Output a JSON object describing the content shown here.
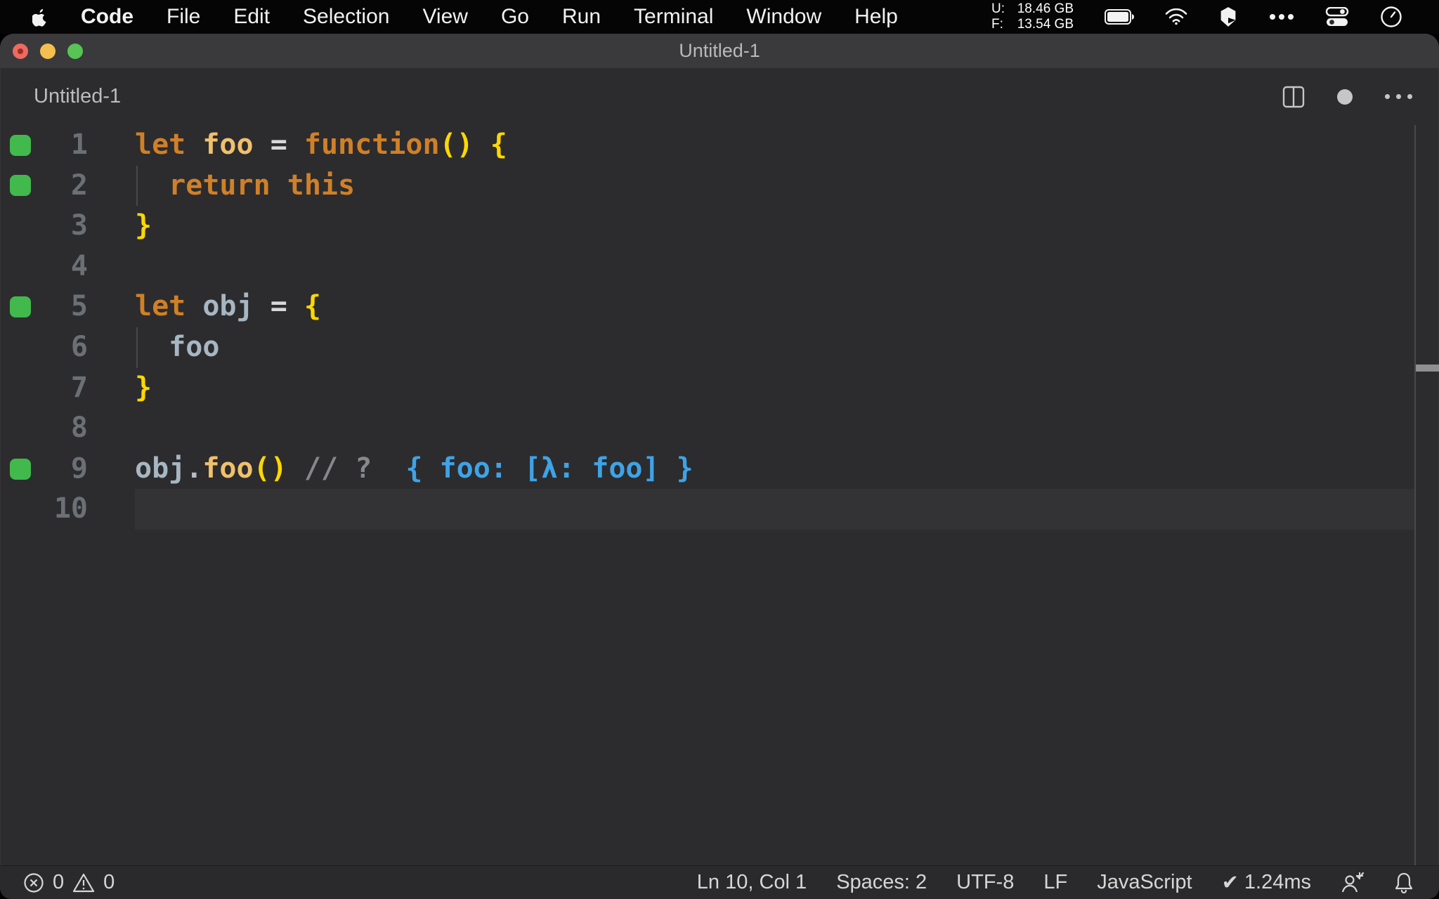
{
  "colors": {
    "menu_bg": "#050505",
    "editor_bg": "#2c2c2e",
    "titlebar_bg": "#3a3a3c",
    "statusbar_bg": "#2a2a2c",
    "current_line": "#333335",
    "line_number": "#6b7075",
    "marker_green": "#41b94d",
    "keyword": "#d08027",
    "function_name": "#f0c06c",
    "variable": "#a7b6c2",
    "punctuation": "#ffd702",
    "operator": "#d8d8d8",
    "comment": "#85898c",
    "annotation": "#3fa3e6",
    "traffic_red": "#ee6a5f",
    "traffic_yellow": "#f5bf4f",
    "traffic_green": "#58c455"
  },
  "menu_bar": {
    "items": [
      "Code",
      "File",
      "Edit",
      "Selection",
      "View",
      "Go",
      "Run",
      "Terminal",
      "Window",
      "Help"
    ],
    "memory": {
      "u_label": "U:",
      "u_value": "18.46 GB",
      "f_label": "F:",
      "f_value": "13.54 GB"
    },
    "icons": [
      "battery-icon",
      "wifi-icon",
      "app-cube-icon",
      "more-dots-icon",
      "control-center-icon",
      "clock-icon"
    ]
  },
  "window": {
    "title": "Untitled-1",
    "tab_label": "Untitled-1",
    "header_icons": [
      "split-editor-icon",
      "unsaved-dot-icon",
      "more-actions-icon"
    ]
  },
  "editor": {
    "language_note": "JavaScript scratch buffer with inline coverage markers and result annotation",
    "lines": [
      {
        "n": "1",
        "marker": true,
        "tokens": [
          [
            "let",
            "kw"
          ],
          [
            " ",
            "pl"
          ],
          [
            "foo",
            "fn"
          ],
          [
            " ",
            "pl"
          ],
          [
            "=",
            "op"
          ],
          [
            " ",
            "pl"
          ],
          [
            "function",
            "kw"
          ],
          [
            "()",
            "pu"
          ],
          [
            " ",
            "pl"
          ],
          [
            "{",
            "pu"
          ]
        ]
      },
      {
        "n": "2",
        "marker": true,
        "guide": true,
        "tokens": [
          [
            "  ",
            "pl"
          ],
          [
            "return",
            "kw"
          ],
          [
            " ",
            "pl"
          ],
          [
            "this",
            "kw"
          ]
        ]
      },
      {
        "n": "3",
        "tokens": [
          [
            "}",
            "pu"
          ]
        ]
      },
      {
        "n": "4",
        "tokens": []
      },
      {
        "n": "5",
        "marker": true,
        "tokens": [
          [
            "let",
            "kw"
          ],
          [
            " ",
            "pl"
          ],
          [
            "obj",
            "vr"
          ],
          [
            " ",
            "pl"
          ],
          [
            "=",
            "op"
          ],
          [
            " ",
            "pl"
          ],
          [
            "{",
            "pu"
          ]
        ]
      },
      {
        "n": "6",
        "guide": true,
        "tokens": [
          [
            "  ",
            "pl"
          ],
          [
            "foo",
            "vr"
          ]
        ]
      },
      {
        "n": "7",
        "tokens": [
          [
            "}",
            "pu"
          ]
        ]
      },
      {
        "n": "8",
        "tokens": []
      },
      {
        "n": "9",
        "marker": true,
        "tokens": [
          [
            "obj",
            "vr"
          ],
          [
            ".",
            "dt"
          ],
          [
            "foo",
            "fn"
          ],
          [
            "()",
            "pu"
          ],
          [
            " ",
            "pl"
          ],
          [
            "// ?",
            "cm"
          ],
          [
            "  ",
            "pl"
          ],
          [
            "{ foo: [λ: foo] }",
            "an"
          ]
        ]
      },
      {
        "n": "10",
        "current": true,
        "tokens": []
      }
    ]
  },
  "status_bar": {
    "error_count": "0",
    "warning_count": "0",
    "items": [
      "Ln 10, Col 1",
      "Spaces: 2",
      "UTF-8",
      "LF",
      "JavaScript"
    ],
    "quokka_check": "✔",
    "quokka_time": "1.24ms",
    "icons": [
      "person-check-icon",
      "bell-icon"
    ]
  }
}
